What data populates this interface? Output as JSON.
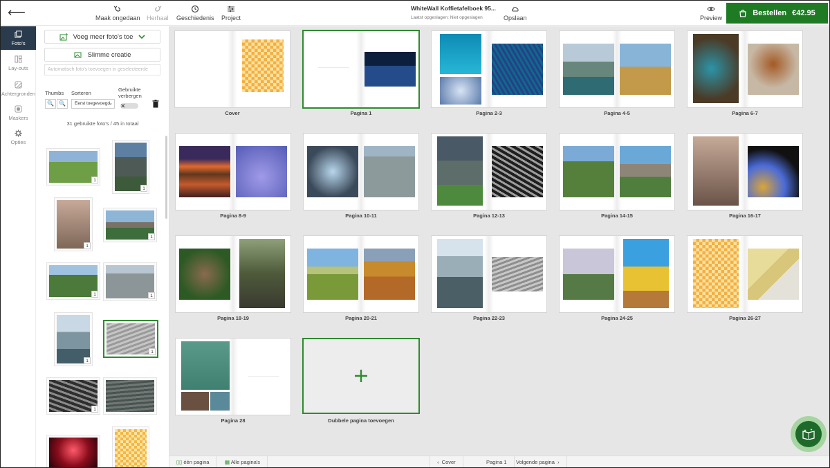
{
  "topbar": {
    "undo_label": "Maak ongedaan",
    "redo_label": "Herhaal",
    "history_label": "Geschiedenis",
    "project_label": "Project",
    "doc_title": "WhiteWall Koffietafelboek 95...",
    "saved_status": "Laatst opgeslagen: Niet opgeslagen",
    "save_label": "Opslaan",
    "preview_label": "Preview",
    "order_label": "Bestellen",
    "order_price": "€42.95"
  },
  "rail": [
    {
      "label": "Foto's",
      "icon": "photos-icon"
    },
    {
      "label": "Lay-outs",
      "icon": "layouts-icon"
    },
    {
      "label": "Achtergronden",
      "icon": "backgrounds-icon"
    },
    {
      "label": "Maskers",
      "icon": "masks-icon"
    },
    {
      "label": "Opties",
      "icon": "options-icon"
    }
  ],
  "panel": {
    "add_photos_label": "Voeg meer foto's toe",
    "smart_creation_label": "Slimme creatie",
    "search_placeholder": "Automatisch foto's toevoegen in geselecteerde",
    "thumbs_label": "Thumbs",
    "sort_label": "Sorteren",
    "sort_value": "Eerst toegevoegd",
    "hide_used_label": "Gebruikte verbergen",
    "count_text": "31 gebruikte foto's / 45 in totaal",
    "badge": "1"
  },
  "spreads": [
    {
      "label": "Cover"
    },
    {
      "label": "Pagina 1"
    },
    {
      "label": "Pagina 2-3"
    },
    {
      "label": "Pagina 4-5"
    },
    {
      "label": "Pagina 6-7"
    },
    {
      "label": "Pagina 8-9"
    },
    {
      "label": "Pagina 10-11"
    },
    {
      "label": "Pagina 12-13"
    },
    {
      "label": "Pagina 14-15"
    },
    {
      "label": "Pagina 16-17"
    },
    {
      "label": "Pagina 18-19"
    },
    {
      "label": "Pagina 20-21"
    },
    {
      "label": "Pagina 22-23"
    },
    {
      "label": "Pagina 24-25"
    },
    {
      "label": "Pagina 26-27"
    },
    {
      "label": "Pagina 28"
    }
  ],
  "add_double_page_label": "Dubbele pagina toevoegen",
  "bottombar": {
    "one_page_label": "één pagina",
    "all_pages_label": "Alle pagina's",
    "prev_label": "Cover",
    "current_label": "Pagina 1",
    "next_label": "Volgende pagina"
  },
  "colors": {
    "accent_green": "#1e7b24",
    "rail_active": "#2a3b4d"
  }
}
